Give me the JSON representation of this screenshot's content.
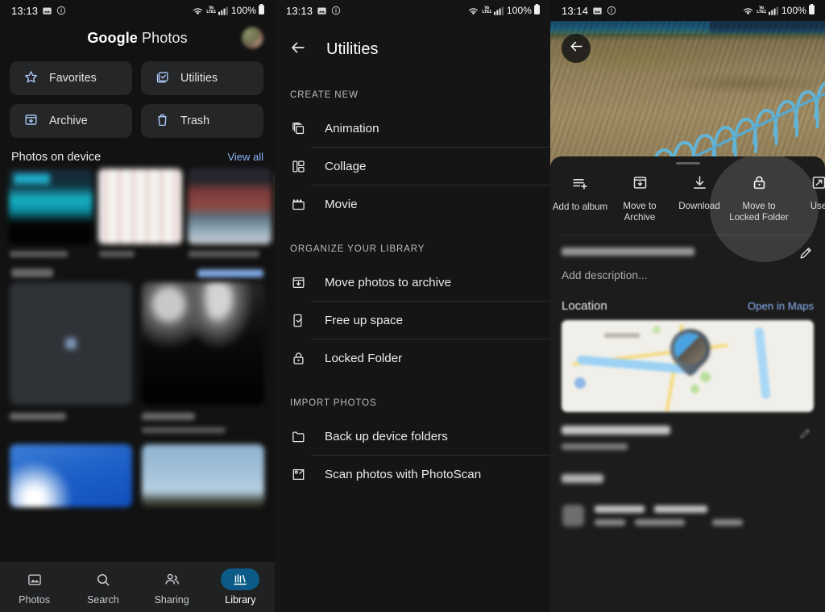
{
  "screens": [
    {
      "name": "library",
      "statusbar": {
        "time": "13:13",
        "icons": [
          "photo-icon",
          "info-icon"
        ],
        "wifi": "wifi-icon",
        "volte": "VoLTE",
        "signal": "signal-bars-icon",
        "battery_text": "100%",
        "battery_icon": "battery-full-icon"
      },
      "header": {
        "brand": "Google",
        "product": "Photos",
        "avatar": "account-avatar"
      },
      "chips": [
        {
          "label": "Favorites",
          "icon": "star-icon"
        },
        {
          "label": "Utilities",
          "icon": "utilities-icon"
        },
        {
          "label": "Archive",
          "icon": "archive-icon"
        },
        {
          "label": "Trash",
          "icon": "trash-icon"
        }
      ],
      "photos_on_device": {
        "title": "Photos on device",
        "action": "View all"
      },
      "bottom_nav": [
        {
          "label": "Photos",
          "icon": "photo-icon",
          "active": false
        },
        {
          "label": "Search",
          "icon": "search-icon",
          "active": false
        },
        {
          "label": "Sharing",
          "icon": "sharing-icon",
          "active": false
        },
        {
          "label": "Library",
          "icon": "library-icon",
          "active": true
        }
      ]
    },
    {
      "name": "utilities",
      "statusbar": {
        "time": "13:13",
        "battery_text": "100%",
        "volte": "VoLTE"
      },
      "title": "Utilities",
      "back": "back-arrow",
      "sections": [
        {
          "heading": "CREATE NEW",
          "items": [
            {
              "label": "Animation",
              "icon": "animation-icon"
            },
            {
              "label": "Collage",
              "icon": "collage-icon"
            },
            {
              "label": "Movie",
              "icon": "movie-icon"
            }
          ]
        },
        {
          "heading": "ORGANIZE YOUR LIBRARY",
          "items": [
            {
              "label": "Move photos to archive",
              "icon": "archive-icon"
            },
            {
              "label": "Free up space",
              "icon": "free-space-icon"
            },
            {
              "label": "Locked Folder",
              "icon": "lock-icon"
            }
          ]
        },
        {
          "heading": "IMPORT PHOTOS",
          "items": [
            {
              "label": "Back up device folders",
              "icon": "folder-icon"
            },
            {
              "label": "Scan photos with PhotoScan",
              "icon": "photoscan-icon"
            }
          ]
        }
      ]
    },
    {
      "name": "photo-detail",
      "statusbar": {
        "time": "13:14",
        "battery_text": "100%",
        "volte": "VoLTE"
      },
      "back": "back-arrow",
      "actions": [
        {
          "label": "Add to album",
          "icon": "add-to-album-icon",
          "highlighted": false
        },
        {
          "label": "Move to Archive",
          "icon": "archive-icon",
          "highlighted": false
        },
        {
          "label": "Download",
          "icon": "download-icon",
          "highlighted": false
        },
        {
          "label": "Move to Locked Folder",
          "icon": "lock-icon",
          "highlighted": true
        },
        {
          "label": "Use",
          "icon": "use-as-icon",
          "highlighted": false
        }
      ],
      "description_placeholder": "Add description...",
      "location": {
        "title": "Location",
        "action": "Open in Maps"
      },
      "edit_icon": "pencil-icon"
    }
  ],
  "colors": {
    "accent_blue": "#8ab4f8",
    "nav_active_pill": "#0c5a87",
    "chip_bg": "#252627",
    "panel_bg": "#121212",
    "sheet_bg": "#1c1c1c"
  }
}
